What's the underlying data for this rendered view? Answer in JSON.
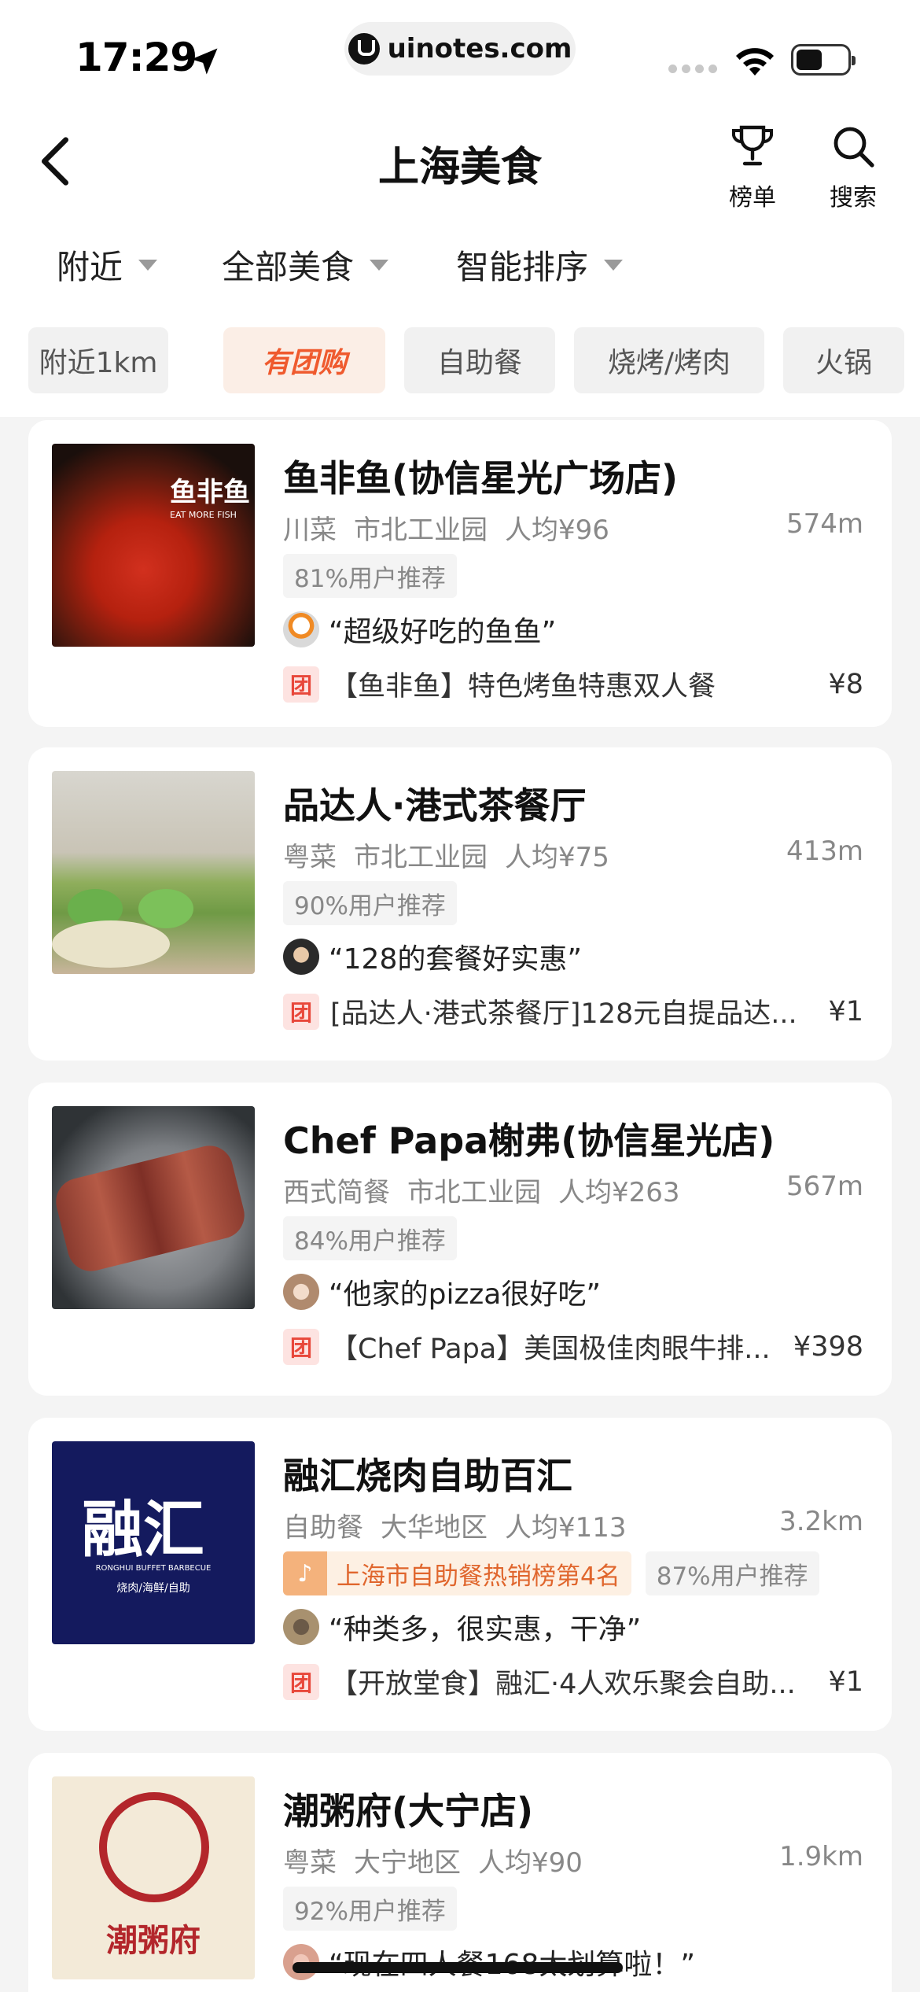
{
  "status_bar": {
    "time": "17:29",
    "url": "uinotes.com"
  },
  "header": {
    "title": "上海美食",
    "rank_label": "榜单",
    "search_label": "搜索"
  },
  "filters": [
    "附近",
    "全部美食",
    "智能排序"
  ],
  "chips": [
    "附近1km",
    "有团购",
    "自助餐",
    "烧烤/烤肉",
    "火锅"
  ],
  "restaurants": [
    {
      "name": "鱼非鱼(协信星光广场店)",
      "cuisine": "川菜",
      "area": "市北工业园",
      "price": "人均¥96",
      "distance": "574m",
      "tags": [
        "81%用户推荐"
      ],
      "review": "“超级好吃的鱼鱼”",
      "deal_badge": "团",
      "deal": "【鱼非鱼】特色烤鱼特惠双人餐",
      "deal_price": "¥8",
      "logo_text": "鱼非鱼",
      "logo_sub": "EAT MORE FISH"
    },
    {
      "name": "品达人·港式茶餐厅",
      "cuisine": "粤菜",
      "area": "市北工业园",
      "price": "人均¥75",
      "distance": "413m",
      "tags": [
        "90%用户推荐"
      ],
      "review": "“128的套餐好实惠”",
      "deal_badge": "团",
      "deal": "[品达人·港式茶餐厅]128元自提品达...",
      "deal_price": "¥1"
    },
    {
      "name": "Chef Papa榭弗(协信星光店)",
      "cuisine": "西式简餐",
      "area": "市北工业园",
      "price": "人均¥263",
      "distance": "567m",
      "tags": [
        "84%用户推荐"
      ],
      "review": "“他家的pizza很好吃”",
      "deal_badge": "团",
      "deal": "【Chef Papa】美国极佳肉眼牛排...",
      "deal_price": "¥398"
    },
    {
      "name": "融汇烧肉自助百汇",
      "cuisine": "自助餐",
      "area": "大华地区",
      "price": "人均¥113",
      "distance": "3.2km",
      "rank_tag": "上海市自助餐热销榜第4名",
      "tags": [
        "87%用户推荐"
      ],
      "review": "“种类多，很实惠，干净”",
      "deal_badge": "团",
      "deal": "【开放堂食】融汇·4人欢乐聚会自助...",
      "deal_price": "¥1",
      "logo_text": "融汇",
      "logo_sub": "RONGHUI BUFFET BARBECUE",
      "logo_sub2": "烧肉/海鲜/自助"
    },
    {
      "name": "潮粥府(大宁店)",
      "cuisine": "粤菜",
      "area": "大宁地区",
      "price": "人均¥90",
      "distance": "1.9km",
      "tags": [
        "92%用户推荐"
      ],
      "review": "“现在四人餐168太划算啦！”",
      "logo_text": "潮粥府"
    }
  ],
  "colors": {
    "accent": "#ef5a2e",
    "deal_red": "#e8473a",
    "rank_orange": "#e0662d",
    "muted": "#888888"
  }
}
